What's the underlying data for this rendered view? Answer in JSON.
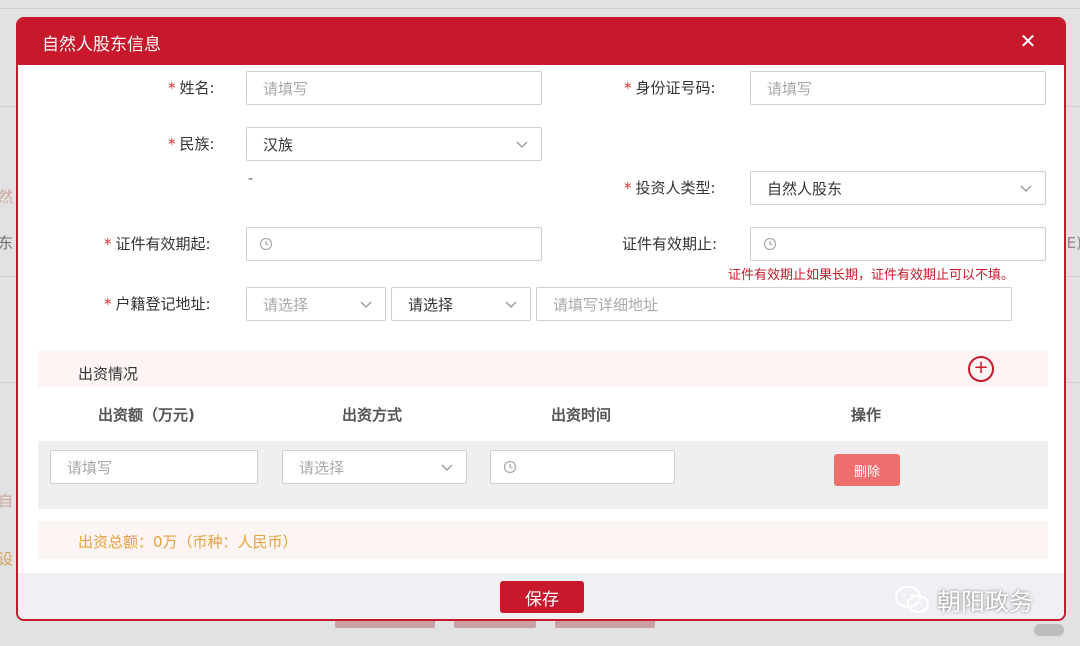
{
  "colors": {
    "brand": "#c7192b",
    "required": "#d9302c",
    "danger": "#ef6e6e",
    "warning": "#e6a23c",
    "placeholder": "#a8a8a8"
  },
  "backdrop": {
    "fragments": [
      "然",
      "东",
      "自",
      "设"
    ],
    "right_fragment": "E)"
  },
  "modal": {
    "title": "自然人股东信息",
    "close_icon": "close-icon"
  },
  "form": {
    "required_mark": "*",
    "name": {
      "label": "姓名:",
      "placeholder": "请填写"
    },
    "id_number": {
      "label": "身份证号码:",
      "placeholder": "请填写"
    },
    "ethnicity": {
      "label": "民族:",
      "value": "汉族"
    },
    "dash": "-",
    "investor_type": {
      "label": "投资人类型:",
      "value": "自然人股东"
    },
    "valid_from": {
      "label": "证件有效期起:"
    },
    "valid_to": {
      "label": "证件有效期止:"
    },
    "valid_hint": "证件有效期止如果长期，证件有效期止可以不填。",
    "address": {
      "label": "户籍登记地址:",
      "select1": "请选择",
      "select2": "请选择",
      "detail_placeholder": "请填写详细地址"
    }
  },
  "contribution": {
    "section_title": "出资情况",
    "add_icon": "plus-circle-icon",
    "columns": [
      "出资额（万元)",
      "出资方式",
      "出资时间",
      "操作"
    ],
    "row": {
      "amount_placeholder": "请填写",
      "method_placeholder": "请选择",
      "delete_label": "删除"
    },
    "total": "出资总额：0万（币种：人民币）"
  },
  "footer": {
    "save_label": "保存"
  },
  "watermark": {
    "text": "朝阳政务",
    "icon": "wechat-icon"
  }
}
